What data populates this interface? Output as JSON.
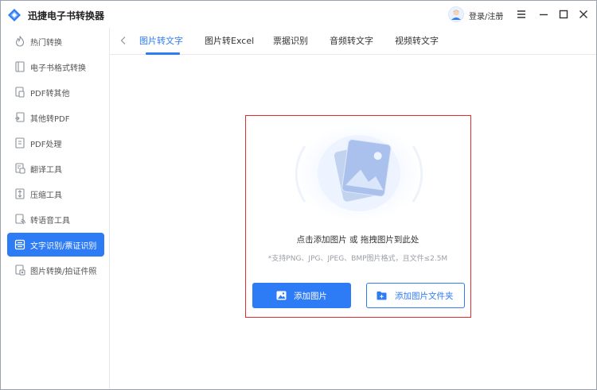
{
  "app": {
    "title": "迅捷电子书转换器",
    "login_label": "登录/注册",
    "accent_color": "#2e7bf6",
    "window_controls": [
      "menu-icon",
      "minimize-icon",
      "maximize-icon",
      "close-icon"
    ]
  },
  "sidebar": {
    "items": [
      {
        "label": "热门转换",
        "icon": "fire-icon"
      },
      {
        "label": "电子书格式转换",
        "icon": "book-icon"
      },
      {
        "label": "PDF转其他",
        "icon": "pdf-convert-icon"
      },
      {
        "label": "其他转PDF",
        "icon": "to-pdf-icon"
      },
      {
        "label": "PDF处理",
        "icon": "pdf-process-icon"
      },
      {
        "label": "翻译工具",
        "icon": "translate-icon"
      },
      {
        "label": "压缩工具",
        "icon": "compress-icon"
      },
      {
        "label": "转语音工具",
        "icon": "voice-icon"
      },
      {
        "label": "文字识别/票证识别",
        "icon": "ocr-icon",
        "active": true
      },
      {
        "label": "图片转换/拍证件照",
        "icon": "image-convert-icon"
      }
    ]
  },
  "tabs": {
    "items": [
      {
        "label": "图片转文字",
        "active": true
      },
      {
        "label": "图片转Excel"
      },
      {
        "label": "票据识别"
      },
      {
        "label": "音频转文字"
      },
      {
        "label": "视频转文字"
      }
    ]
  },
  "dropzone": {
    "title": "点击添加图片 或 拖拽图片到此处",
    "hint": "*支持PNG、JPG、JPEG、BMP图片格式，且文件≤2.5M",
    "add_image_label": "添加图片",
    "add_folder_label": "添加图片文件夹",
    "border_color": "#e02d2d"
  }
}
